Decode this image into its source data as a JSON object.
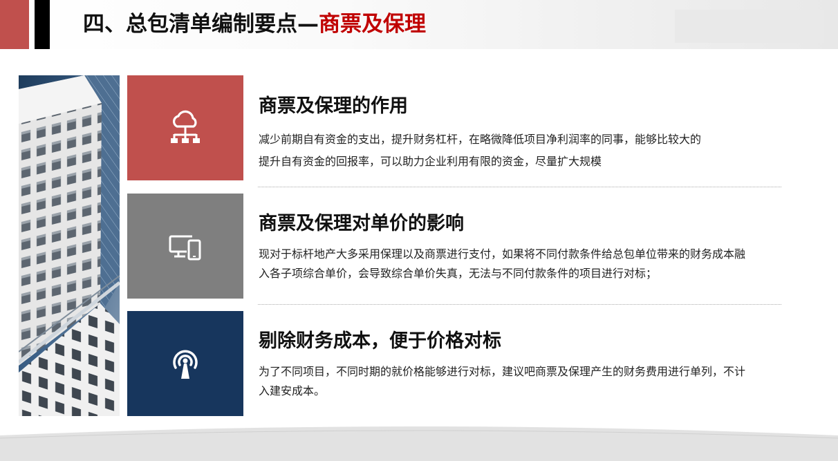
{
  "header": {
    "title_main": "四、总包清单编制要点—",
    "title_accent": "商票及保理"
  },
  "colors": {
    "accent_red": "#c00000",
    "tile_red": "#c0504d",
    "tile_gray": "#7f7f7f",
    "tile_navy": "#17365d"
  },
  "sections": [
    {
      "icon": "cloud-network-icon",
      "title": "商票及保理的作用",
      "line1": "减少前期自有资金的支出，提升财务杠杆，在略微降低项目净利润率的同事，能够比较大的",
      "line2": "提升自有资金的回报率，可以助力企业利用有限的资金，尽量扩大规模"
    },
    {
      "icon": "devices-icon",
      "title": "商票及保理对单价的影响",
      "line1": "现对于标杆地产大多采用保理以及商票进行支付，如果将不同付款条件给总包单位带来的财务成本融",
      "line2": "入各子项综合单价，会导致综合单价失真，无法与不同付款条件的项目进行对标；"
    },
    {
      "icon": "broadcast-tower-icon",
      "title": "剔除财务成本，便于价格对标",
      "line1": "为了不同项目，不同时期的就价格能够进行对标，建议吧商票及保理产生的财务费用进行单列，不计",
      "line2": "入建安成本。"
    }
  ]
}
